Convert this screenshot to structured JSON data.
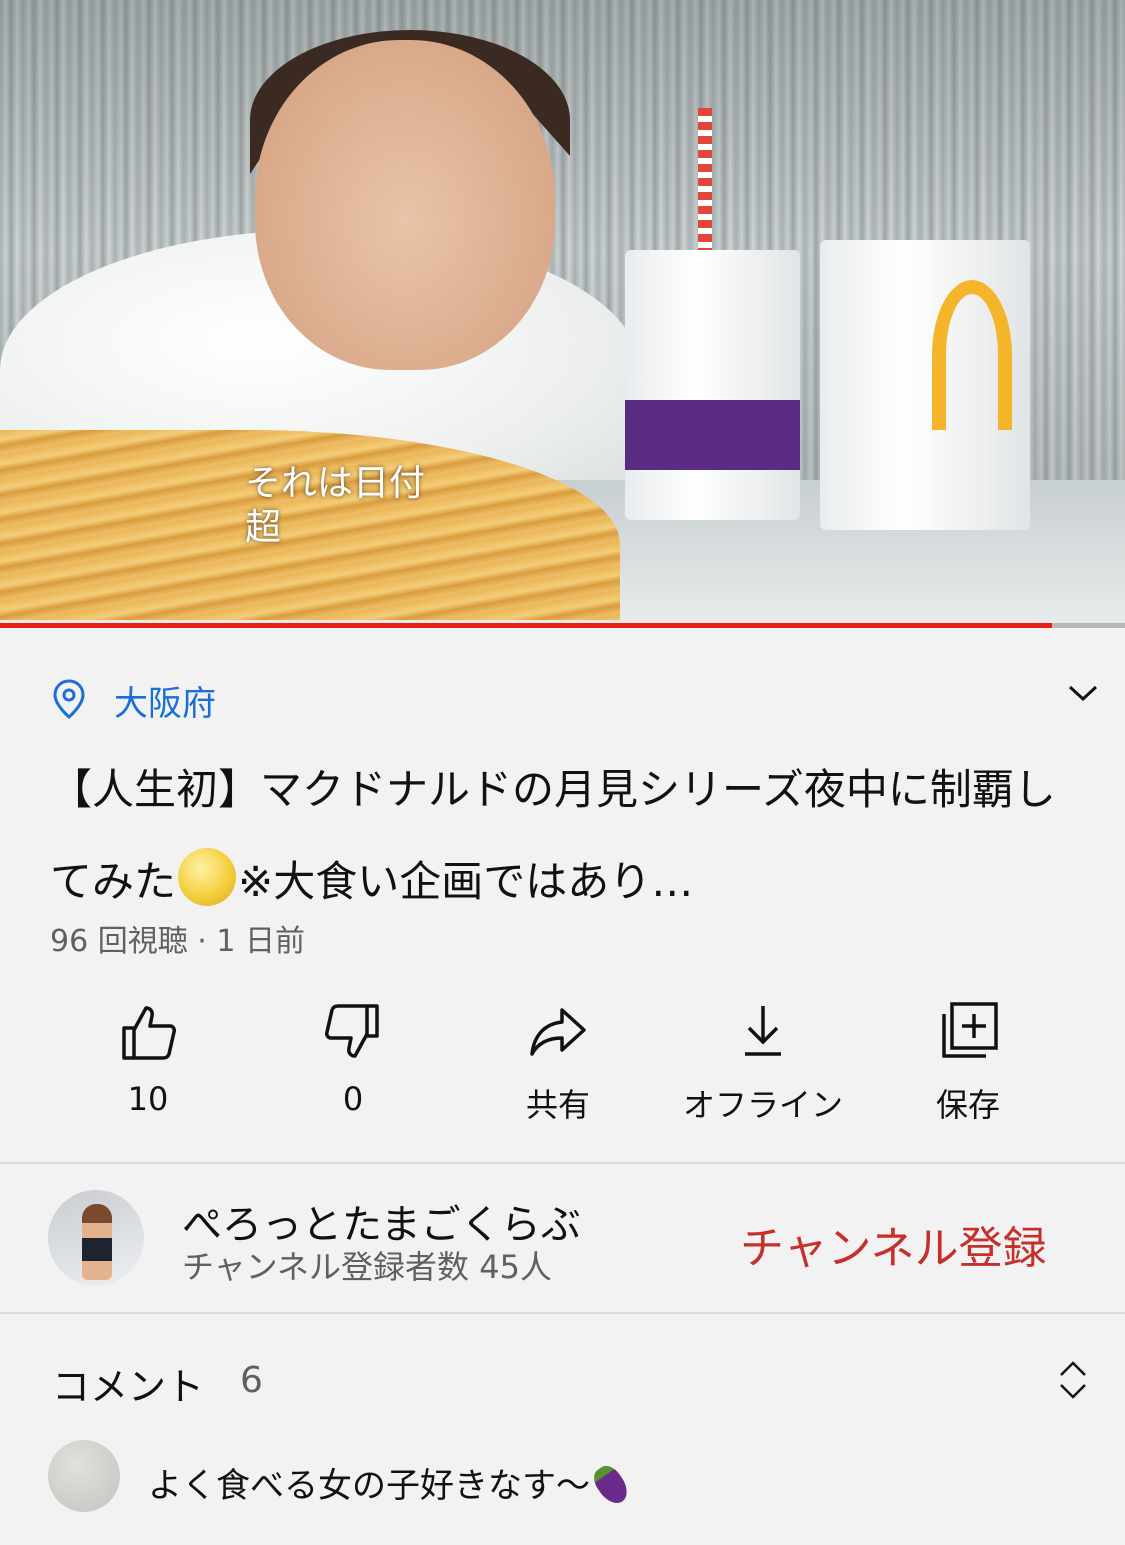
{
  "video": {
    "caption_line1": "それは日付",
    "caption_line2": "超",
    "progress_fraction": 0.935
  },
  "info": {
    "location": "大阪府",
    "title_part1": "【人生初】マクドナルドの月見シリーズ夜中に制覇してみた",
    "title_part2": "※大食い企画ではあり…",
    "views": "96 回視聴",
    "time_ago": "1 日前",
    "meta_separator": "·"
  },
  "actions": {
    "like_count": "10",
    "dislike_count": "0",
    "share_label": "共有",
    "offline_label": "オフライン",
    "save_label": "保存"
  },
  "channel": {
    "name": "ぺろっとたまごくらぶ",
    "subscribers": "チャンネル登録者数 45人",
    "subscribe_label": "チャンネル登録"
  },
  "comments": {
    "title": "コメント",
    "count": "6",
    "top_comment": "よく食べる女の子好きなす〜"
  },
  "colors": {
    "accent_red": "#c4302b",
    "progress_red": "#e62117",
    "link_blue": "#1a6ed8"
  },
  "icons": [
    "location-pin-icon",
    "chevron-down-icon",
    "thumbs-up-icon",
    "thumbs-down-icon",
    "share-arrow-icon",
    "download-icon",
    "add-to-playlist-icon",
    "expand-collapse-icon",
    "moon-emoji-icon",
    "eggplant-emoji-icon"
  ]
}
